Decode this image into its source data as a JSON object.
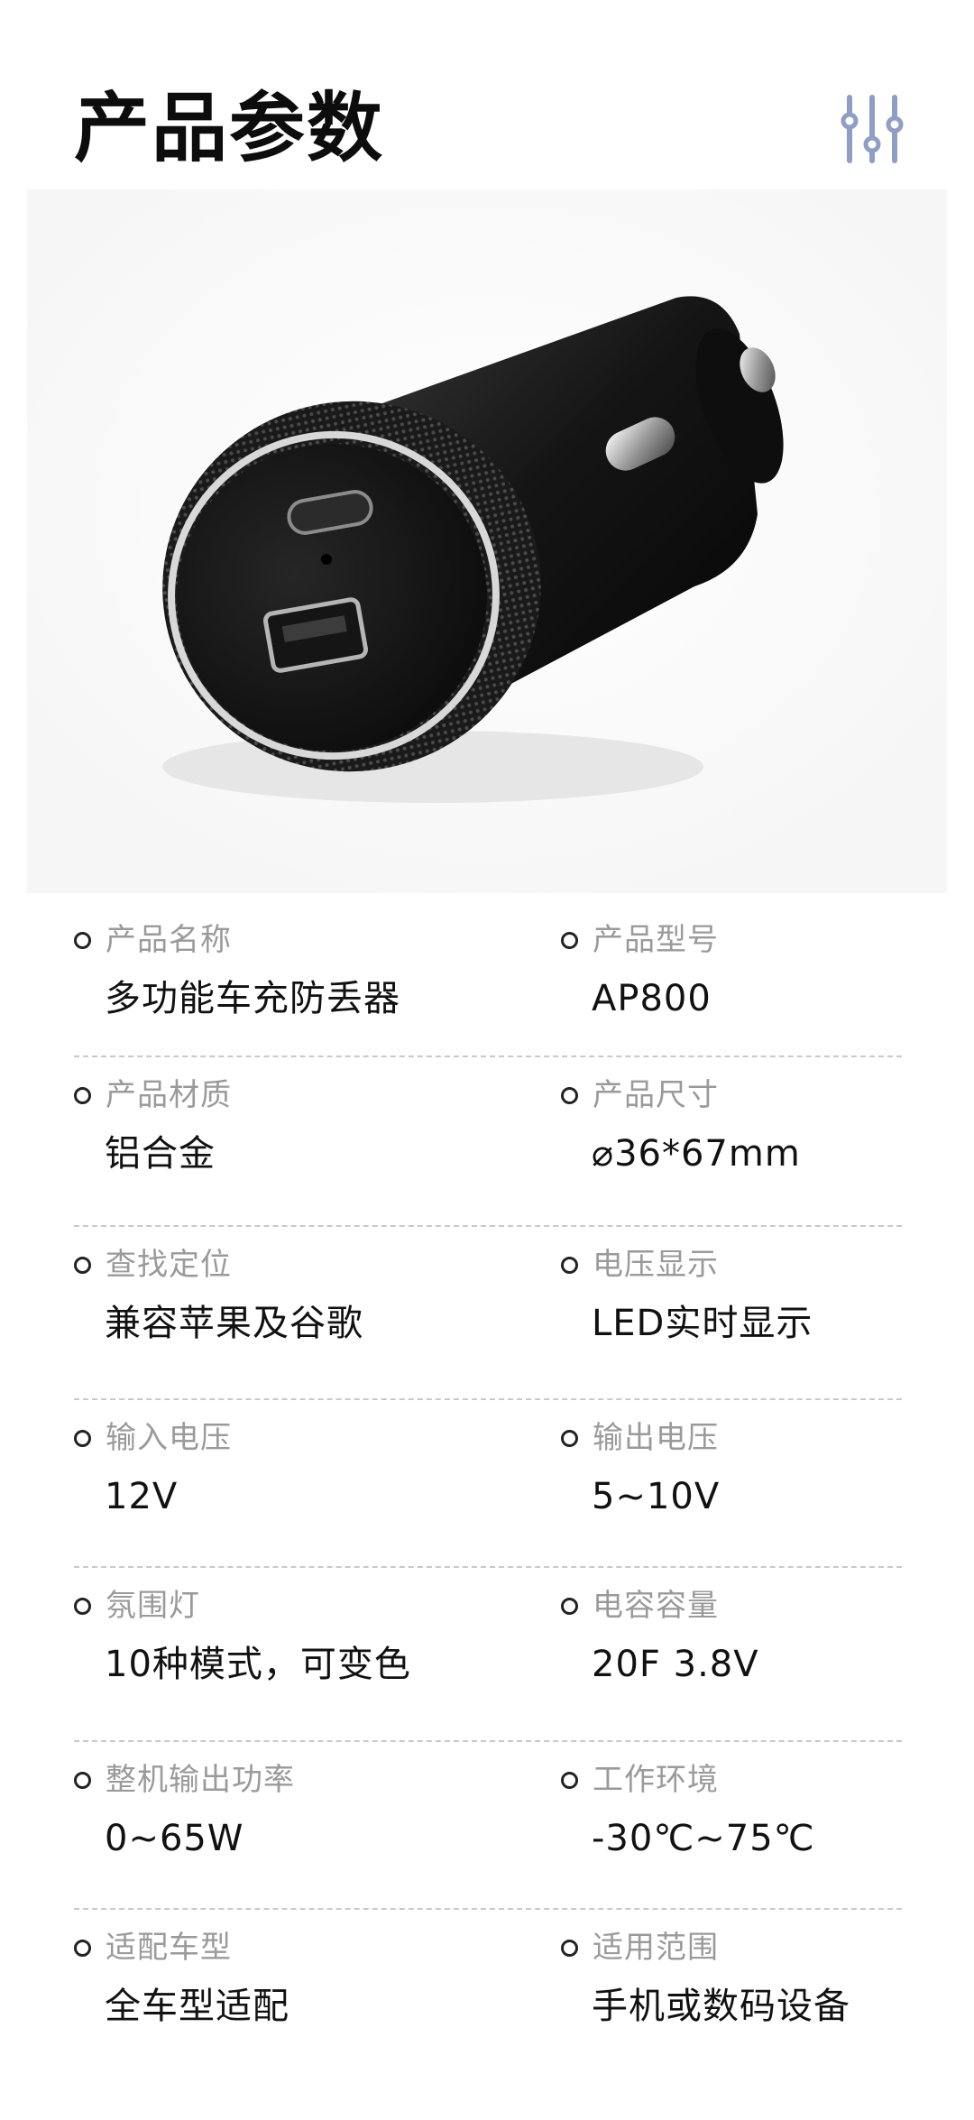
{
  "header": {
    "title": "产品参数",
    "icon": "sliders-icon",
    "accent_color": "#8f9ec4"
  },
  "product_image": {
    "subject": "car-charger-photo"
  },
  "specs": [
    {
      "left": {
        "label": "产品名称",
        "value": "多功能车充防丢器"
      },
      "right": {
        "label": "产品型号",
        "value": "AP800"
      }
    },
    {
      "left": {
        "label": "产品材质",
        "value": "铝合金"
      },
      "right": {
        "label": "产品尺寸",
        "value": "⌀36*67mm"
      }
    },
    {
      "left": {
        "label": "查找定位",
        "value": "兼容苹果及谷歌"
      },
      "right": {
        "label": "电压显示",
        "value": "LED实时显示"
      }
    },
    {
      "left": {
        "label": "输入电压",
        "value": "12V"
      },
      "right": {
        "label": "输出电压",
        "value": "5~10V"
      }
    },
    {
      "left": {
        "label": "氛围灯",
        "value": "10种模式，可变色"
      },
      "right": {
        "label": "电容容量",
        "value": "20F 3.8V"
      }
    },
    {
      "left": {
        "label": "整机输出功率",
        "value": "0~65W"
      },
      "right": {
        "label": "工作环境",
        "value": "-30℃~75℃"
      }
    },
    {
      "left": {
        "label": "适配车型",
        "value": "全车型适配"
      },
      "right": {
        "label": "适用范围",
        "value": "手机或数码设备"
      }
    }
  ]
}
